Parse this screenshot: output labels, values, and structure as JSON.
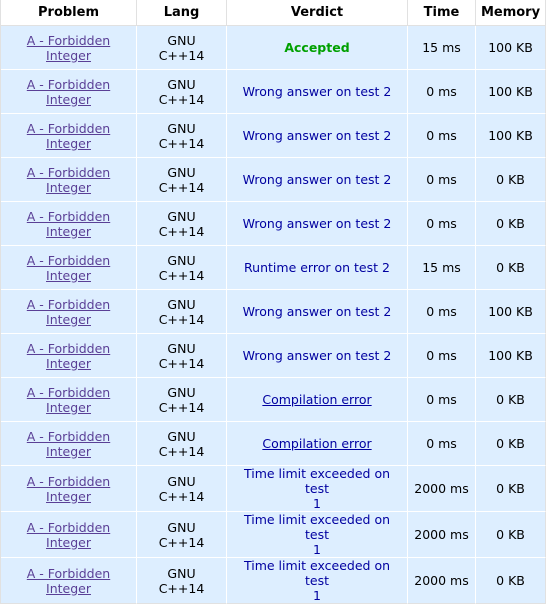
{
  "header": {
    "problem": "Problem",
    "lang": "Lang",
    "verdict": "Verdict",
    "time": "Time",
    "memory": "Memory"
  },
  "rows": [
    {
      "problem_l1": "A - Forbidden",
      "problem_l2": "Integer",
      "lang_l1": "GNU",
      "lang_l2": "C++14",
      "verdict": "Accepted",
      "verdict_kind": "accepted",
      "time": "15 ms",
      "memory": "100 KB"
    },
    {
      "problem_l1": "A - Forbidden",
      "problem_l2": "Integer",
      "lang_l1": "GNU",
      "lang_l2": "C++14",
      "verdict": "Wrong answer on test 2",
      "verdict_kind": "text",
      "time": "0 ms",
      "memory": "100 KB"
    },
    {
      "problem_l1": "A - Forbidden",
      "problem_l2": "Integer",
      "lang_l1": "GNU",
      "lang_l2": "C++14",
      "verdict": "Wrong answer on test 2",
      "verdict_kind": "text",
      "time": "0 ms",
      "memory": "100 KB"
    },
    {
      "problem_l1": "A - Forbidden",
      "problem_l2": "Integer",
      "lang_l1": "GNU",
      "lang_l2": "C++14",
      "verdict": "Wrong answer on test 2",
      "verdict_kind": "text",
      "time": "0 ms",
      "memory": "0 KB"
    },
    {
      "problem_l1": "A - Forbidden",
      "problem_l2": "Integer",
      "lang_l1": "GNU",
      "lang_l2": "C++14",
      "verdict": "Wrong answer on test 2",
      "verdict_kind": "text",
      "time": "0 ms",
      "memory": "0 KB"
    },
    {
      "problem_l1": "A - Forbidden",
      "problem_l2": "Integer",
      "lang_l1": "GNU",
      "lang_l2": "C++14",
      "verdict": "Runtime error on test 2",
      "verdict_kind": "text",
      "time": "15 ms",
      "memory": "0 KB"
    },
    {
      "problem_l1": "A - Forbidden",
      "problem_l2": "Integer",
      "lang_l1": "GNU",
      "lang_l2": "C++14",
      "verdict": "Wrong answer on test 2",
      "verdict_kind": "text",
      "time": "0 ms",
      "memory": "100 KB"
    },
    {
      "problem_l1": "A - Forbidden",
      "problem_l2": "Integer",
      "lang_l1": "GNU",
      "lang_l2": "C++14",
      "verdict": "Wrong answer on test 2",
      "verdict_kind": "text",
      "time": "0 ms",
      "memory": "100 KB"
    },
    {
      "problem_l1": "A - Forbidden",
      "problem_l2": "Integer",
      "lang_l1": "GNU",
      "lang_l2": "C++14",
      "verdict": "Compilation error",
      "verdict_kind": "link",
      "time": "0 ms",
      "memory": "0 KB"
    },
    {
      "problem_l1": "A - Forbidden",
      "problem_l2": "Integer",
      "lang_l1": "GNU",
      "lang_l2": "C++14",
      "verdict": "Compilation error",
      "verdict_kind": "link",
      "time": "0 ms",
      "memory": "0 KB"
    },
    {
      "problem_l1": "A - Forbidden",
      "problem_l2": "Integer",
      "lang_l1": "GNU",
      "lang_l2": "C++14",
      "verdict_l1": "Time limit exceeded on test",
      "verdict_l2": "1",
      "verdict_kind": "twoline",
      "time": "2000 ms",
      "memory": "0 KB"
    },
    {
      "problem_l1": "A - Forbidden",
      "problem_l2": "Integer",
      "lang_l1": "GNU",
      "lang_l2": "C++14",
      "verdict_l1": "Time limit exceeded on test",
      "verdict_l2": "1",
      "verdict_kind": "twoline",
      "time": "2000 ms",
      "memory": "0 KB"
    },
    {
      "problem_l1": "A - Forbidden",
      "problem_l2": "Integer",
      "lang_l1": "GNU",
      "lang_l2": "C++14",
      "verdict_l1": "Time limit exceeded on test",
      "verdict_l2": "1",
      "verdict_kind": "twoline",
      "time": "2000 ms",
      "memory": "0 KB"
    }
  ]
}
